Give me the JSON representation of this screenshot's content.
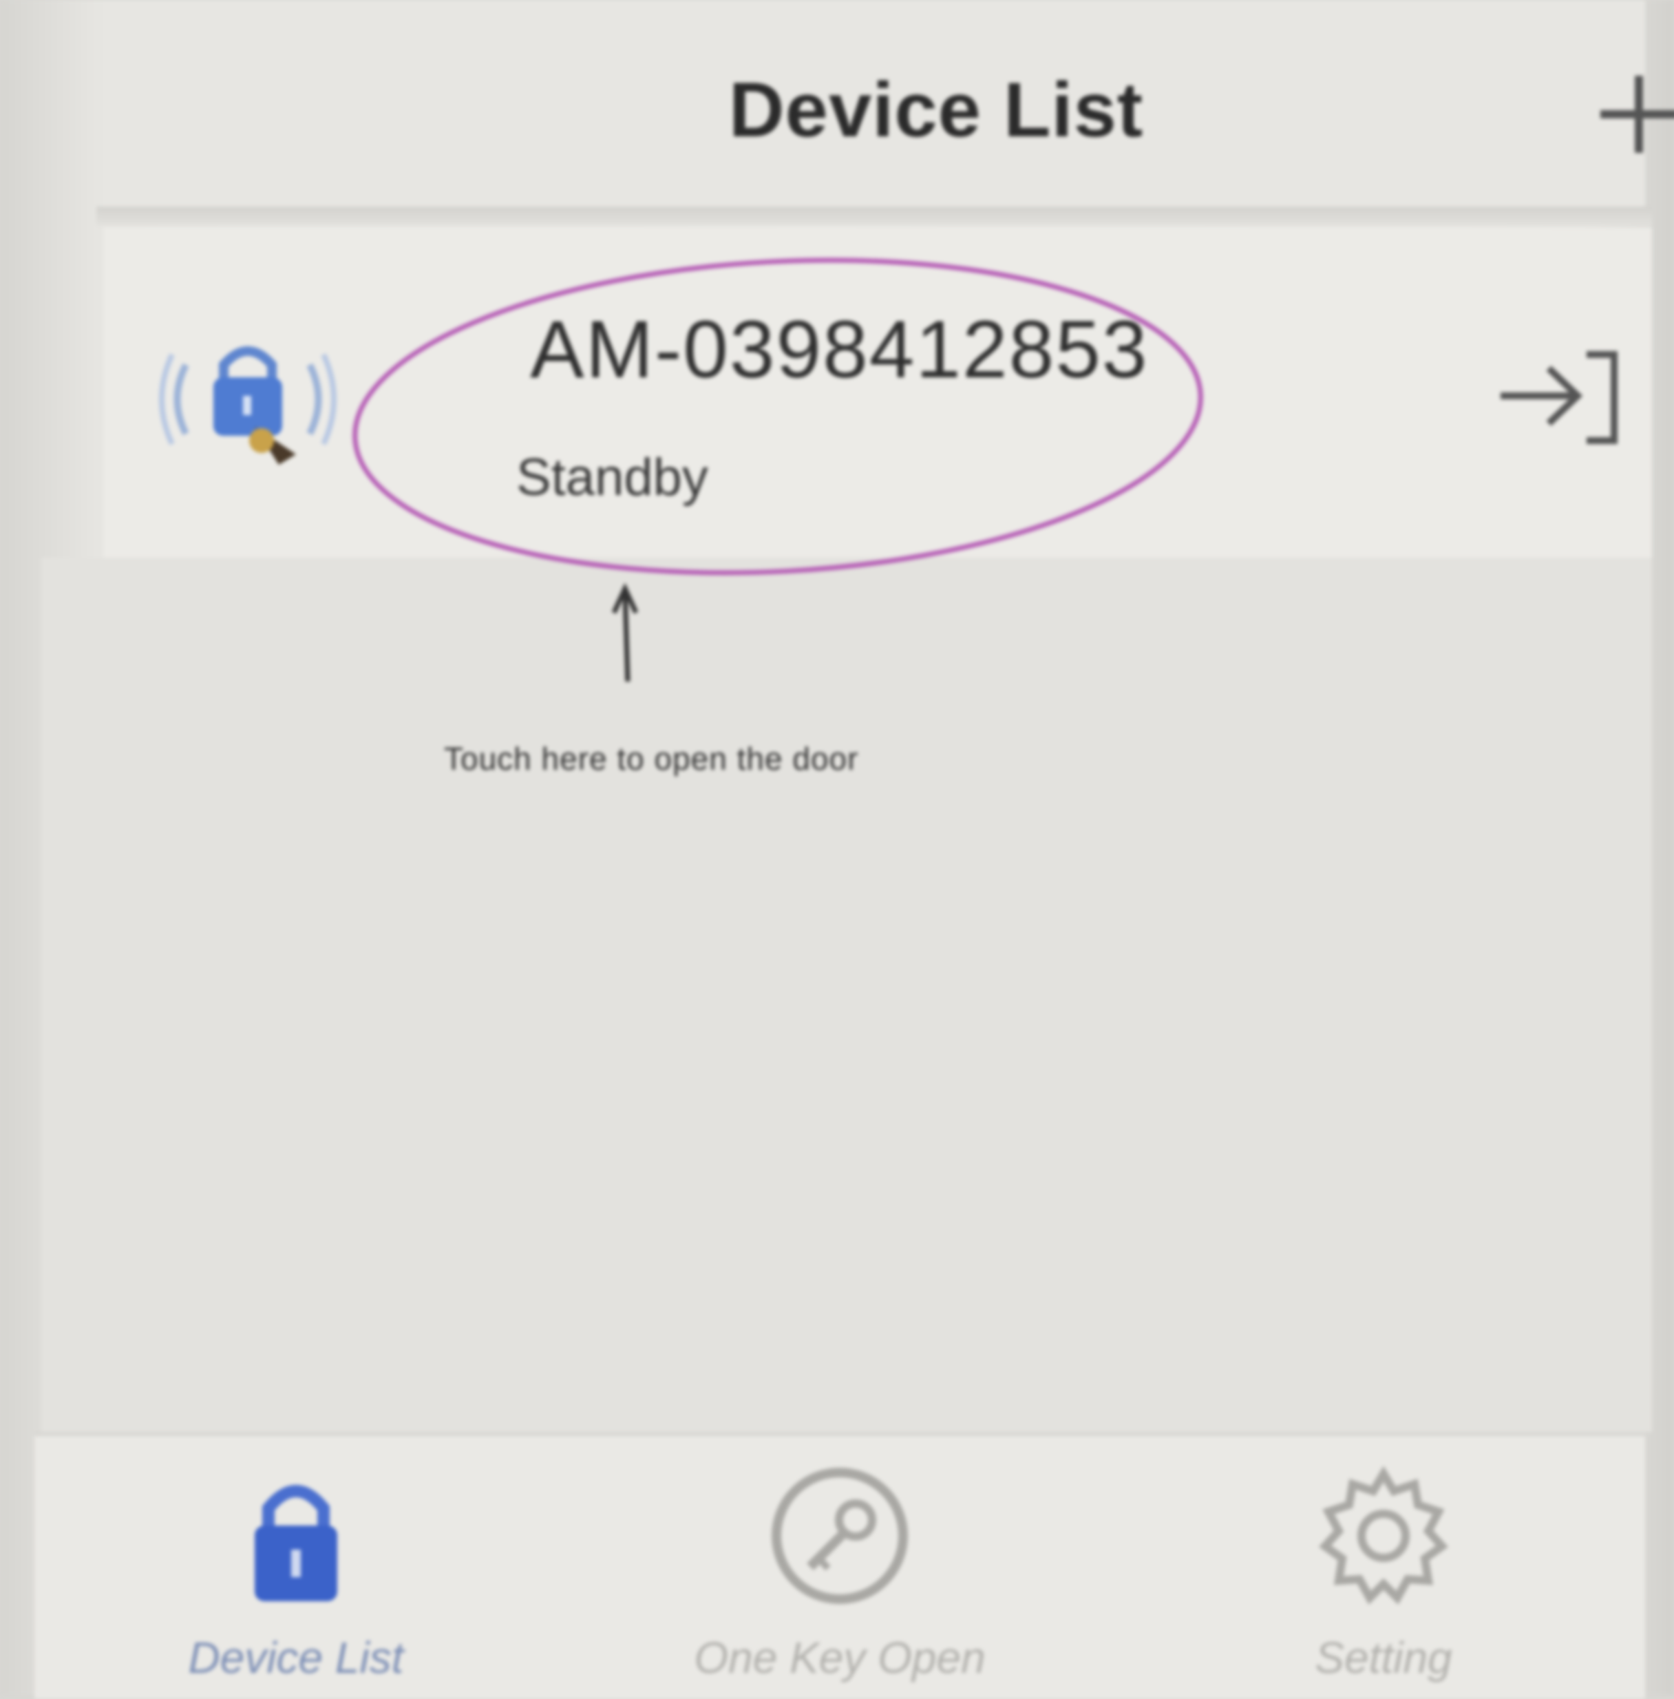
{
  "header": {
    "title": "Device List",
    "add_icon": "plus-icon"
  },
  "device": {
    "name": "AM-0398412853",
    "status": "Standby",
    "icon": "bluetooth-lock-icon",
    "action_icon": "enter-arrow-icon"
  },
  "annotation": {
    "text": "Touch here to open the door",
    "color": "#b55bb5"
  },
  "tabs": [
    {
      "label": "Device List",
      "icon": "lock-icon",
      "active": true
    },
    {
      "label": "One Key Open",
      "icon": "key-circle-icon",
      "active": false
    },
    {
      "label": "Setting",
      "icon": "gear-icon",
      "active": false
    }
  ],
  "colors": {
    "accent": "#3b62c9",
    "inactive": "#a9a8a4",
    "annotation": "#b55bb5"
  }
}
